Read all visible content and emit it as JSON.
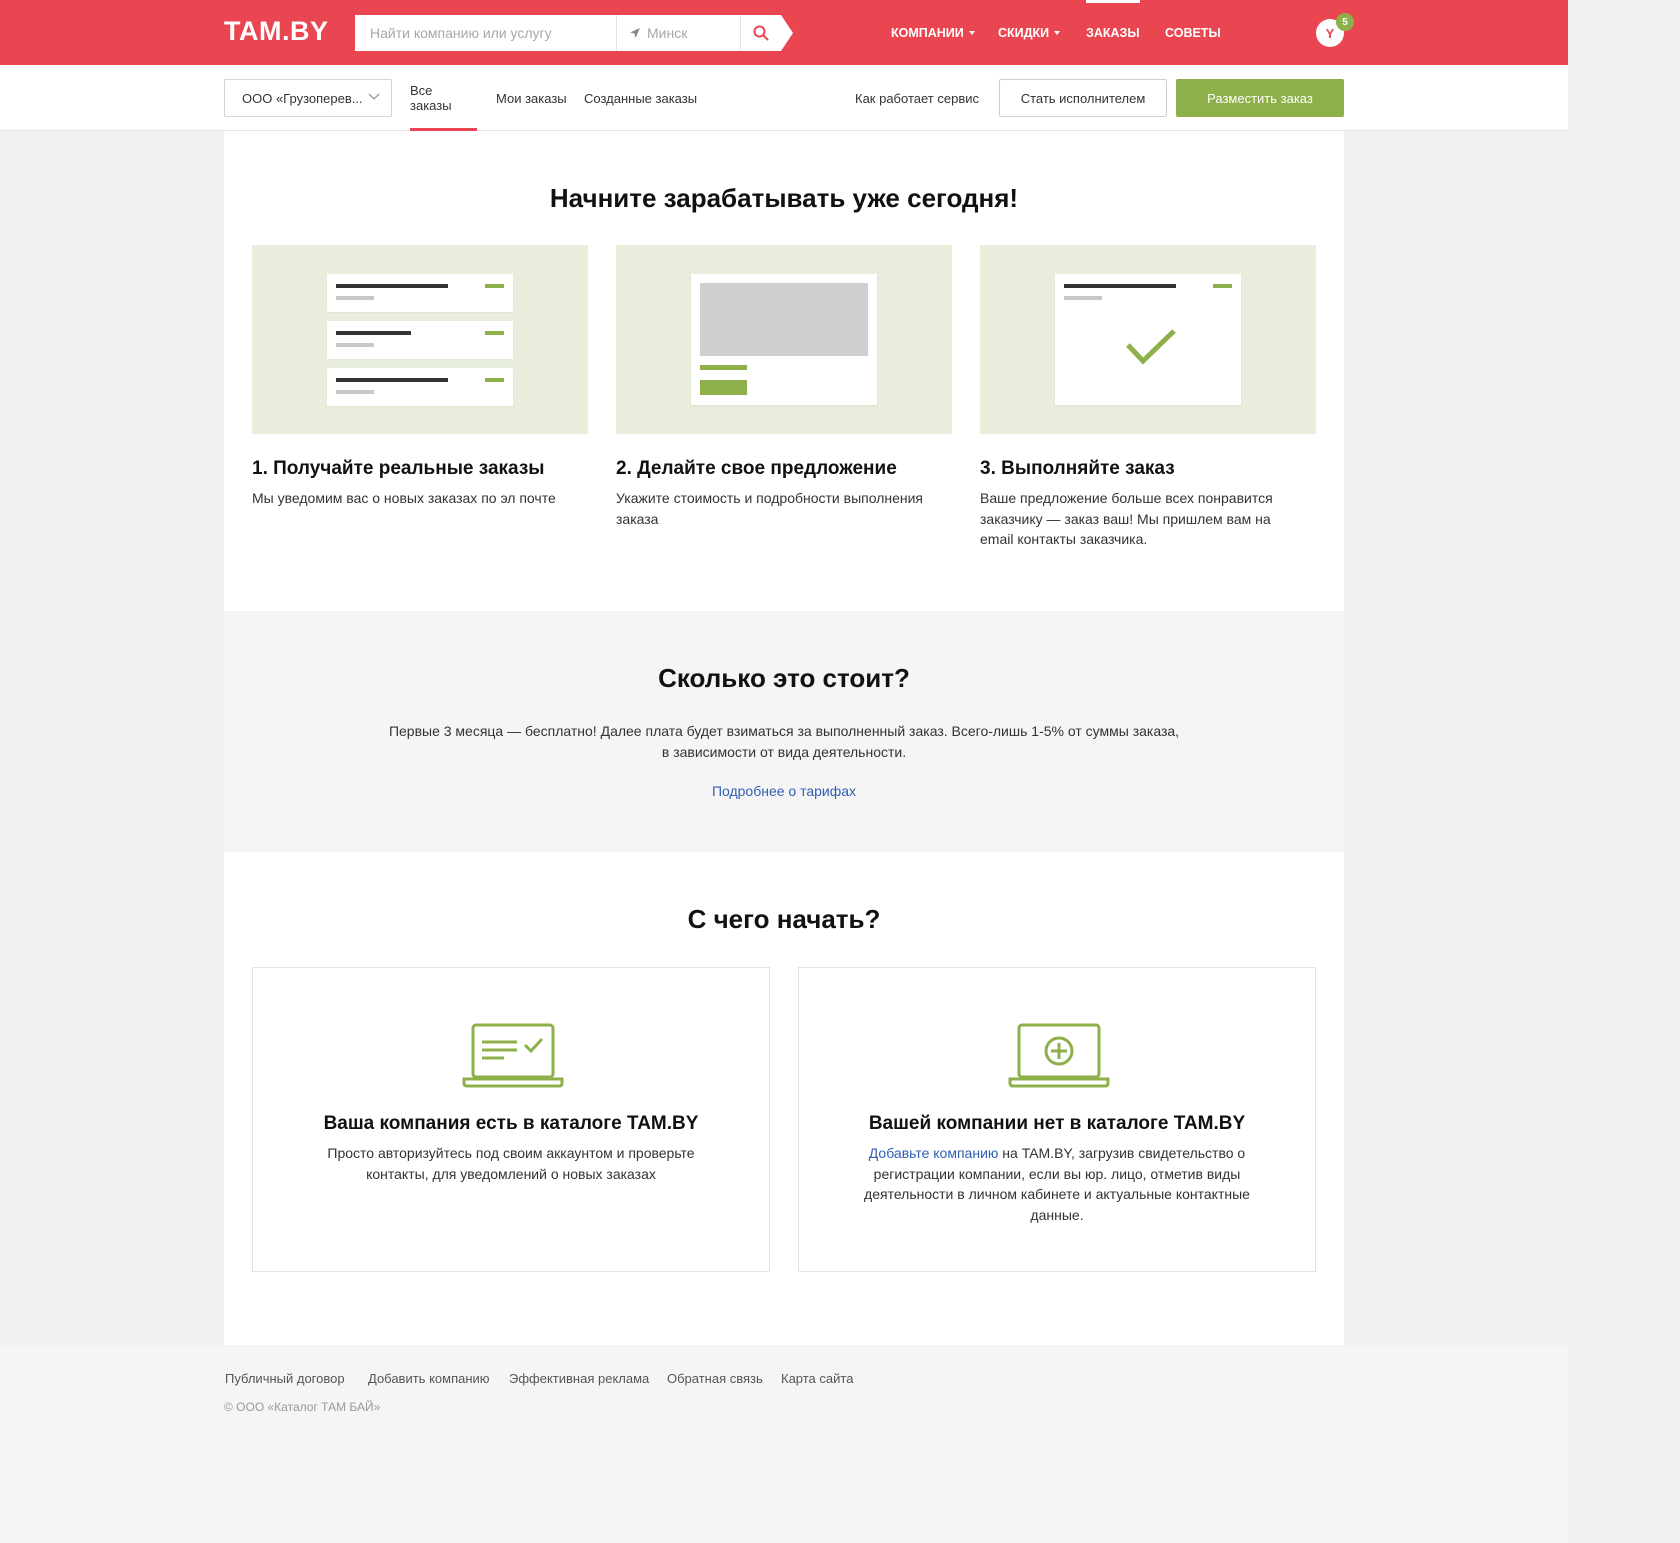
{
  "header": {
    "logo": "TAM.BY",
    "search_placeholder": "Найти компанию или услугу",
    "city": "Минск",
    "nav": [
      {
        "label": "КОМПАНИИ"
      },
      {
        "label": "СКИДКИ"
      },
      {
        "label": "ЗАКАЗЫ"
      },
      {
        "label": "СОВЕТЫ"
      }
    ],
    "avatar_letter": "Y",
    "notification_count": "5",
    "accent_color": "#e94651"
  },
  "subnav": {
    "company": "ООО «Грузоперев...",
    "tabs": [
      {
        "label": "Все заказы"
      },
      {
        "label": "Мои заказы"
      },
      {
        "label": "Созданные заказы"
      }
    ],
    "how_it_works": "Как работает сервис",
    "become_executor": "Стать исполнителем",
    "place_order": "Разместить заказ",
    "green_color": "#8db04a"
  },
  "intro": {
    "title": "Начните зарабатывать уже сегодня!",
    "steps": [
      {
        "title": "1. Получайте реальные заказы",
        "text": "Мы уведомим вас о новых заказах по эл почте"
      },
      {
        "title": "2. Делайте свое предложение",
        "text": "Укажите стоимость и подробности выполнения заказа"
      },
      {
        "title": "3. Выполняйте заказ",
        "text": "Ваше предложение больше всех понравится заказчику — заказ ваш! Мы пришлем вам на email контакты заказчика."
      }
    ]
  },
  "pricing": {
    "title": "Сколько это стоит?",
    "text": "Первые 3 месяца — бесплатно! Далее плата будет взиматься за выполненный заказ. Всего-лишь 1-5% от суммы заказа, в зависимости от вида деятельности.",
    "link": "Подробнее о тарифах"
  },
  "start": {
    "title": "С чего начать?",
    "cards": [
      {
        "title": "Ваша компания есть в каталоге TAM.BY",
        "text": "Просто авторизуйтесь под своим аккаунтом и проверьте контакты, для уведомлений о новых заказах"
      },
      {
        "title": "Вашей компании нет в каталоге TAM.BY",
        "link": "Добавьте компанию",
        "text": " на TAM.BY, загрузив свидетельство о регистрации компании, если вы юр. лицо, отметив виды деятельности в личном кабинете и актуальные контактные данные."
      }
    ]
  },
  "footer": {
    "links": [
      {
        "label": "Публичный договор"
      },
      {
        "label": "Добавить компанию"
      },
      {
        "label": "Эффективная реклама"
      },
      {
        "label": "Обратная связь"
      },
      {
        "label": "Карта сайта"
      }
    ],
    "copyright": "© ООО «Каталог ТАМ БАЙ»"
  }
}
